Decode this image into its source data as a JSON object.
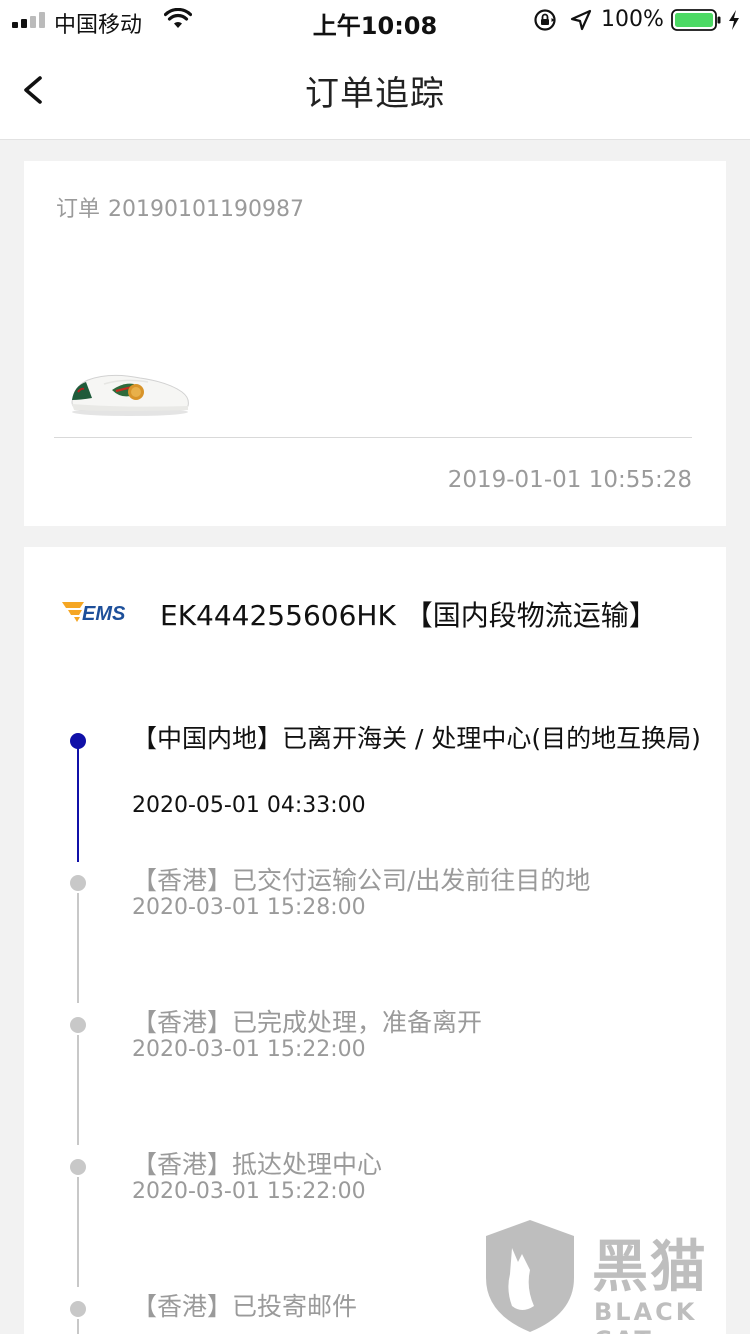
{
  "status_bar": {
    "carrier": "中国移动",
    "time": "上午10:08",
    "battery_pct": "100%"
  },
  "nav": {
    "title": "订单追踪"
  },
  "order": {
    "label": "订单",
    "number": "20190101190987",
    "time": "2019-01-01 10:55:28"
  },
  "shipment": {
    "carrier_logo_text": "EMS",
    "tracking_number": "EK444255606HK 【国内段物流运输】"
  },
  "events": [
    {
      "text": "【中国内地】已离开海关 / 处理中心(目的地互换局)",
      "time": "2020-05-01 04:33:00",
      "active": true
    },
    {
      "text": "【香港】已交付运输公司/出发前往目的地",
      "time": "2020-03-01 15:28:00",
      "active": false
    },
    {
      "text": "【香港】已完成处理，准备离开",
      "time": "2020-03-01 15:22:00",
      "active": false
    },
    {
      "text": "【香港】抵达处理中心",
      "time": "2020-03-01 15:22:00",
      "active": false
    },
    {
      "text": "【香港】已投寄邮件",
      "time": "",
      "active": false
    }
  ],
  "watermark": {
    "cn": "黑猫",
    "en": "BLACK CAT"
  },
  "colors": {
    "timeline_active": "#1010a8",
    "timeline_inactive": "#c8c8c8",
    "ems_orange": "#f5a623",
    "ems_blue": "#1d4f9a",
    "battery_green": "#4cd964"
  }
}
